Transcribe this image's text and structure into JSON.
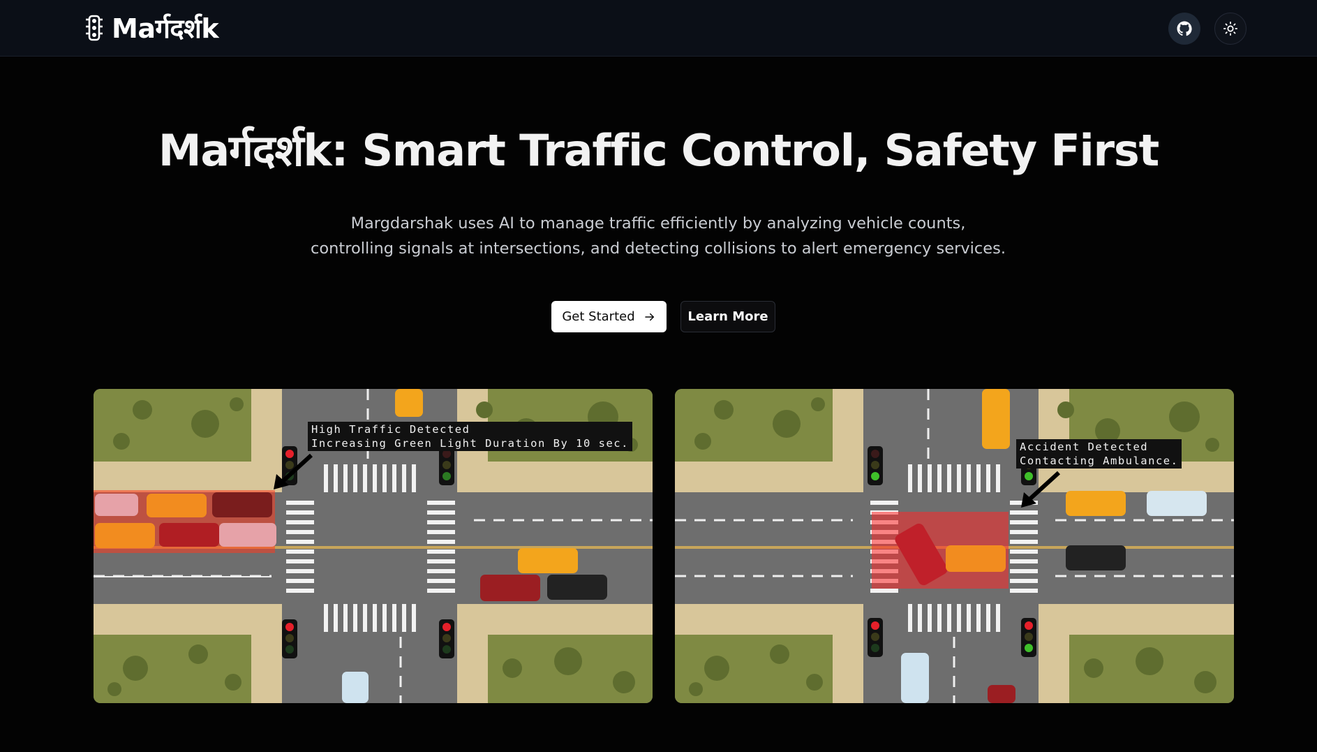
{
  "nav": {
    "brand": "Maर्गदर्शk",
    "github_icon": "github-icon",
    "theme_icon": "sun-icon"
  },
  "hero": {
    "title": "Maर्गदर्शk: Smart Traffic Control, Safety First",
    "description": "Margdarshak uses AI to manage traffic efficiently by analyzing vehicle counts, controlling signals at intersections, and detecting collisions to alert emergency services.",
    "primary_cta": "Get Started",
    "secondary_cta": "Learn More"
  },
  "demos": {
    "traffic": {
      "line1": "High Traffic Detected",
      "line2": "Increasing Green Light Duration By 10 sec."
    },
    "accident": {
      "line1": "Accident Detected",
      "line2": "Contacting Ambulance."
    }
  },
  "colors": {
    "background": "#030303",
    "navbar": "#0b0f17",
    "grass": "#7f8a43",
    "road": "#6e6e6e",
    "sidewalk": "#d8c69a"
  }
}
